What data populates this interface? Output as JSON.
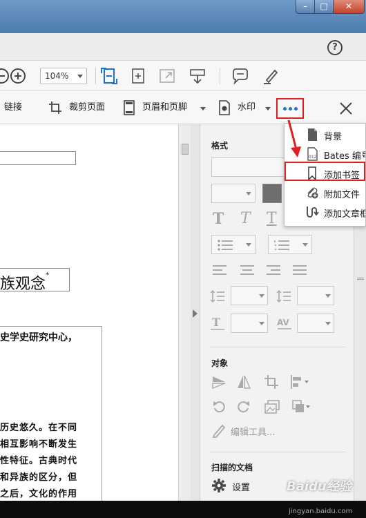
{
  "window": {
    "minimize": "–",
    "maximize": "□",
    "close": "✕"
  },
  "menubar": {
    "help": "?"
  },
  "toolbar1": {
    "zoom": "104%"
  },
  "toolbar2": {
    "link": "链接",
    "crop": "裁剪页面",
    "header_footer": "页眉和页脚",
    "watermark": "水印"
  },
  "document": {
    "heading": "族观念",
    "heading_mark": "*",
    "line1": "史学史研究中心，",
    "para": [
      "历史悠久。在不同",
      "相互影响不断发生",
      "性特征。古典时代",
      "和异族的区分，但",
      "之后，文化的作用"
    ]
  },
  "panel": {
    "format_title": "格式",
    "objects_title": "对象",
    "edit_tools": "编辑工具...",
    "scan_title": "扫描的文档",
    "settings": "设置"
  },
  "more_menu": [
    {
      "label": "背景",
      "icon": "page-background-icon"
    },
    {
      "label": "Bates 编号",
      "icon": "bates-number-icon"
    },
    {
      "label": "添加书签",
      "icon": "bookmark-icon"
    },
    {
      "label": "附加文件",
      "icon": "attach-file-icon"
    },
    {
      "label": "添加文章框",
      "icon": "add-article-icon"
    }
  ],
  "watermark": {
    "brand": "Baidu经验",
    "url": "jingyan.baidu.com"
  },
  "colors": {
    "highlight": "#e02020",
    "accent_blue": "#1f6fd1",
    "title_bar": "#5a86b8"
  }
}
